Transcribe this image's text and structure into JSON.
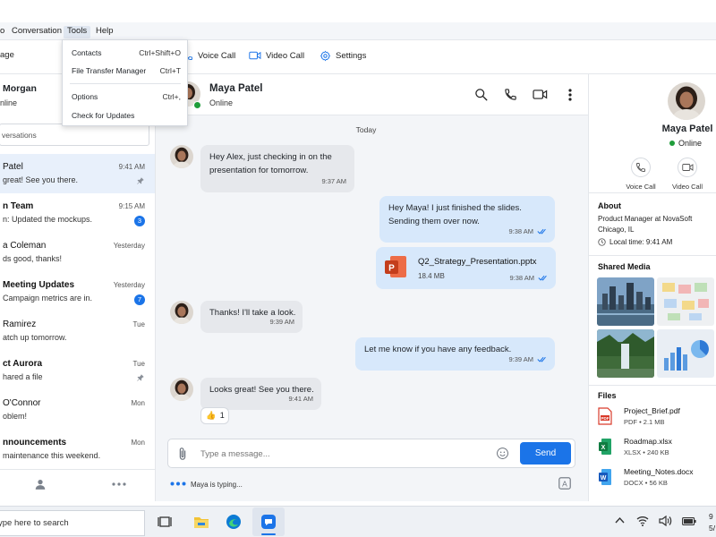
{
  "menubar": {
    "items": [
      {
        "label": "o"
      },
      {
        "label": "Conversation"
      },
      {
        "label": "Tools"
      },
      {
        "label": "Help"
      }
    ]
  },
  "tools_menu": {
    "items": [
      {
        "label": "Contacts",
        "shortcut": "Ctrl+Shift+O"
      },
      {
        "label": "File Transfer Manager",
        "shortcut": "Ctrl+T"
      },
      {
        "label": "Options",
        "shortcut": "Ctrl+,"
      },
      {
        "label": "Check for Updates",
        "shortcut": ""
      }
    ]
  },
  "toolbar": {
    "left_label": "age",
    "voice_call": "Voice Call",
    "video_call": "Video Call",
    "settings": "Settings"
  },
  "sidebar": {
    "user_name": "Morgan",
    "user_status": "nline",
    "search_placeholder": "versations",
    "conversations": [
      {
        "name": "Patel",
        "preview": "great! See you there.",
        "time": "9:41 AM",
        "badge": "",
        "pinned": true,
        "active": true
      },
      {
        "name": "n Team",
        "preview": "n: Updated the mockups.",
        "time": "9:15 AM",
        "badge": "3",
        "pinned": false,
        "active": false
      },
      {
        "name": "a Coleman",
        "preview": "ds good, thanks!",
        "time": "Yesterday",
        "badge": "",
        "pinned": false,
        "active": false
      },
      {
        "name": "Meeting Updates",
        "preview": "Campaign metrics are in.",
        "time": "Yesterday",
        "badge": "7",
        "pinned": false,
        "active": false
      },
      {
        "name": "Ramirez",
        "preview": "atch up tomorrow.",
        "time": "Tue",
        "badge": "",
        "pinned": false,
        "active": false
      },
      {
        "name": "ct Aurora",
        "preview": "hared a file",
        "time": "Tue",
        "badge": "",
        "pinned": true,
        "active": false
      },
      {
        "name": "O'Connor",
        "preview": "oblem!",
        "time": "Mon",
        "badge": "",
        "pinned": false,
        "active": false
      },
      {
        "name": "nnouncements",
        "preview": "maintenance this weekend.",
        "time": "Mon",
        "badge": "",
        "pinned": false,
        "active": false
      }
    ]
  },
  "chat": {
    "contact_name": "Maya Patel",
    "contact_status": "Online",
    "day_label": "Today",
    "messages": [
      {
        "dir": "in",
        "lines": [
          "Hey Alex, just checking in on the",
          "presentation for tomorrow."
        ],
        "time": "9:37 AM"
      },
      {
        "dir": "out",
        "lines": [
          "Hey Maya! I just finished the slides.",
          "Sending them over now."
        ],
        "time": "9:38 AM"
      },
      {
        "dir": "file",
        "file_name": "Q2_Strategy_Presentation.pptx",
        "file_size": "18.4 MB",
        "time": "9:38 AM"
      },
      {
        "dir": "in",
        "lines": [
          "Thanks! I'll take a look."
        ],
        "time": "9:39 AM"
      },
      {
        "dir": "out",
        "lines": [
          "Let me know if you have any feedback."
        ],
        "time": "9:39 AM"
      },
      {
        "dir": "in",
        "lines": [
          "Looks great! See you there."
        ],
        "time": "9:41 AM"
      }
    ],
    "reaction_emoji": "👍",
    "reaction_count": "1",
    "composer_placeholder": "Type a message...",
    "send_label": "Send",
    "typing_text": "Maya is typing..."
  },
  "panel": {
    "name": "Maya Patel",
    "status": "Online",
    "voice_call": "Voice Call",
    "video_call": "Video Call",
    "about_title": "About",
    "title": "Product Manager at NovaSoft",
    "location": "Chicago, IL",
    "local_time": "Local time: 9:41 AM",
    "media_title": "Shared Media",
    "files_title": "Files",
    "files": [
      {
        "name": "Project_Brief.pdf",
        "meta": "PDF  •  2.1 MB",
        "type": "pdf"
      },
      {
        "name": "Roadmap.xlsx",
        "meta": "XLSX  •  240 KB",
        "type": "xlsx"
      },
      {
        "name": "Meeting_Notes.docx",
        "meta": "DOCX  •  56 KB",
        "type": "docx"
      }
    ]
  },
  "taskbar": {
    "search_placeholder": "ype here to search",
    "clock_time": "9",
    "clock_date": "5/"
  },
  "colors": {
    "accent": "#1b74e8",
    "online": "#1f9d3a",
    "bubble_in": "#e6e8ec",
    "bubble_out": "#d7e8fb"
  }
}
